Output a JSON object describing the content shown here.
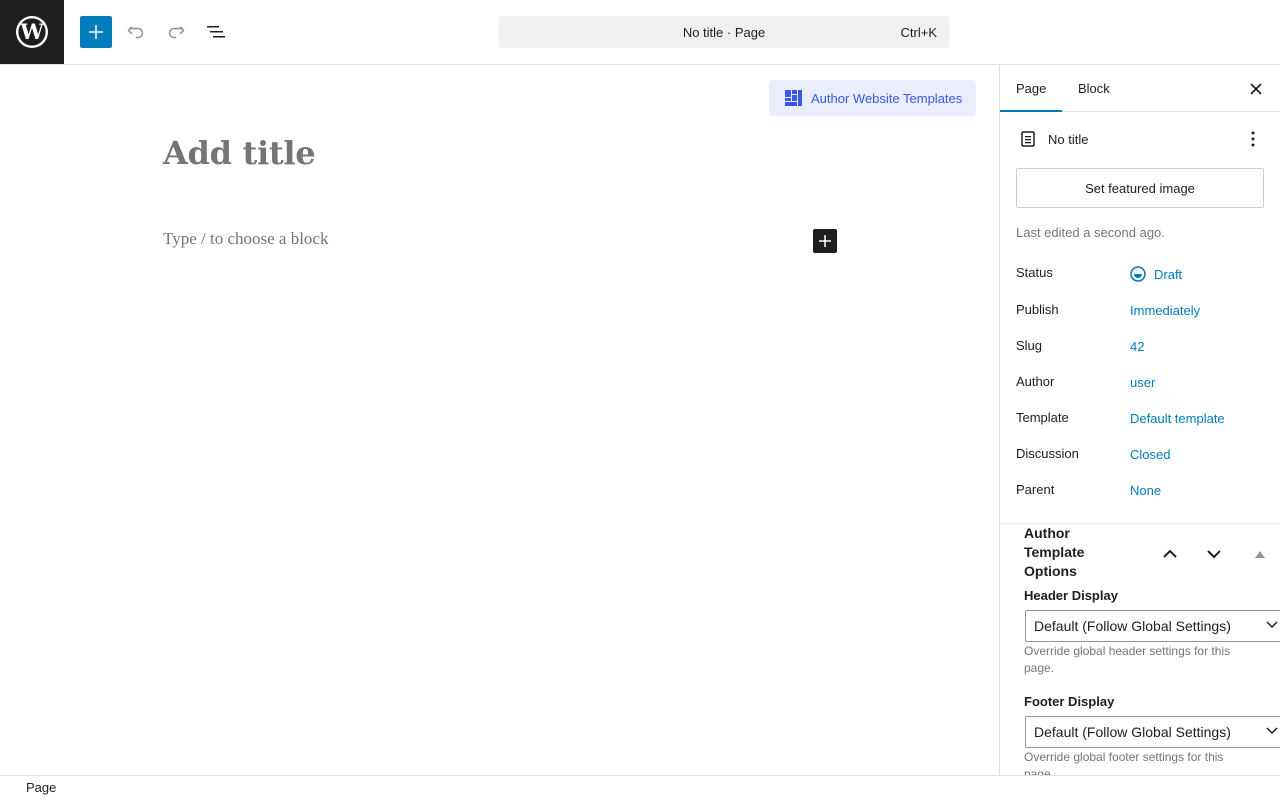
{
  "topbar": {
    "logo": "wordpress-logo",
    "inserter_icon": "plus-icon",
    "undo_icon": "undo-icon",
    "redo_icon": "redo-icon",
    "list_view_icon": "list-view-icon",
    "command_text": "No title · Page",
    "command_shortcut": "Ctrl+K"
  },
  "canvas": {
    "template_button": "Author Website Templates",
    "title_placeholder": "Add title",
    "block_placeholder": "Type / to choose a block"
  },
  "sidebar": {
    "tabs": [
      {
        "label": "Page",
        "active": true
      },
      {
        "label": "Block",
        "active": false
      }
    ],
    "doc_title": "No title",
    "featured_image_button": "Set featured image",
    "last_edited": "Last edited a second ago.",
    "meta": [
      {
        "label": "Status",
        "value": "Draft"
      },
      {
        "label": "Publish",
        "value": "Immediately"
      },
      {
        "label": "Slug",
        "value": "42"
      },
      {
        "label": "Author",
        "value": "user"
      },
      {
        "label": "Template",
        "value": "Default template"
      },
      {
        "label": "Discussion",
        "value": "Closed"
      },
      {
        "label": "Parent",
        "value": "None"
      }
    ],
    "panel": {
      "title": "Author Template Options",
      "header_display": {
        "label": "Header Display",
        "value": "Default (Follow Global Settings)",
        "help": "Override global header settings for this page."
      },
      "footer_display": {
        "label": "Footer Display",
        "value": "Default (Follow Global Settings)",
        "help": "Override global footer settings for this page."
      }
    }
  },
  "footer": {
    "breadcrumb": "Page"
  },
  "colors": {
    "accent": "#007cba",
    "dark": "#1e1e1e",
    "template_button_bg": "#eaeefc",
    "template_button_text": "#3858e9",
    "muted": "#757575"
  }
}
